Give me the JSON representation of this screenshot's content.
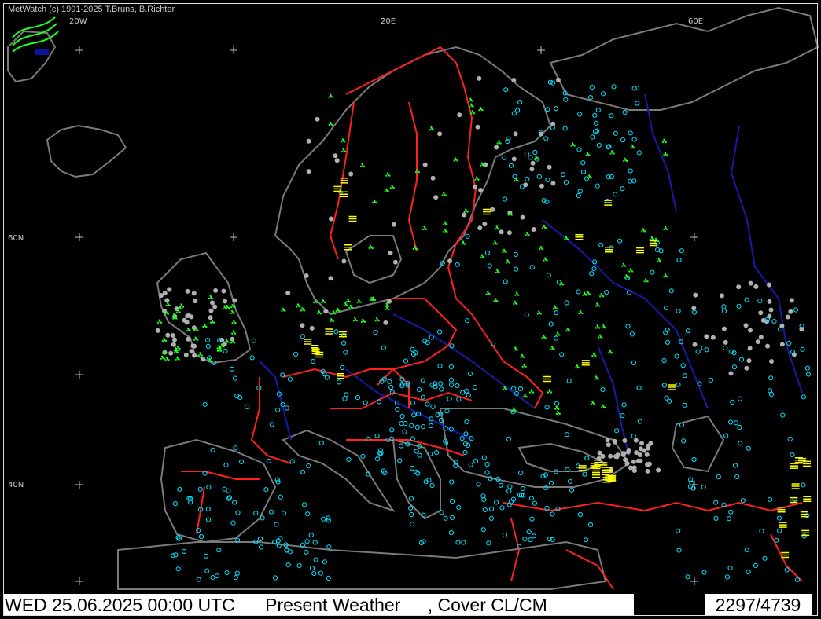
{
  "app": {
    "credit": "MetWatch  (c) 1991-2025 T.Bruns, B.Richter"
  },
  "map": {
    "grid_labels": {
      "lon_20w": "20W",
      "lon_20e": "20E",
      "lon_60e": "60E",
      "lat_60n": "60N",
      "lat_40n": "40N"
    },
    "colors": {
      "background": "#000000",
      "coast": "#808080",
      "borders": "#ff2020",
      "rivers": "#1010a0",
      "station_clear": "#00e0ff",
      "station_cloudy": "#b0b0b0",
      "rain": "#20ff20",
      "fog": "#ffff00"
    }
  },
  "status": {
    "datetime": "WED 25.06.2025 00:00 UTC",
    "product": "Present Weather",
    "cover": ", Cover CL/CM",
    "count": "2297/4739"
  }
}
